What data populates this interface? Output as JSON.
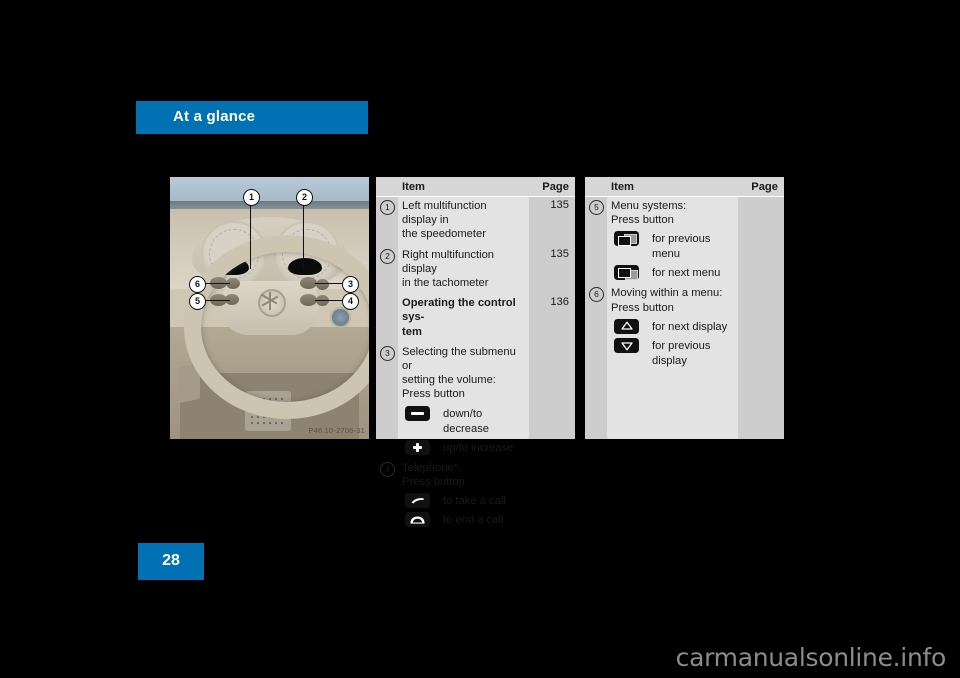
{
  "header": {
    "title": "At a glance"
  },
  "figure": {
    "code": "P46.10-2706-31",
    "callouts": [
      "1",
      "2",
      "3",
      "4",
      "5",
      "6"
    ]
  },
  "tables": [
    {
      "name": "left-table",
      "headers": {
        "item": "Item",
        "page": "Page"
      },
      "rows": [
        {
          "num": "1",
          "lines": [
            "Left multifunction display in",
            "the speedometer"
          ],
          "bold": false,
          "page": "135"
        },
        {
          "num": "2",
          "lines": [
            "Right multifunction display",
            "in the tachometer"
          ],
          "bold": false,
          "page": "135"
        },
        {
          "num": "",
          "lines": [
            "Operating the control sys-",
            "tem"
          ],
          "bold": true,
          "page": "136"
        },
        {
          "num": "3",
          "lines": [
            "Selecting the submenu or",
            "setting the volume:",
            "Press button"
          ],
          "bold": false,
          "page": ""
        }
      ],
      "icon_rows_a": [
        {
          "icon": "minus-button-icon",
          "label": "down/to decrease"
        },
        {
          "icon": "plus-button-icon",
          "label": "up/to increase"
        }
      ],
      "row_b": {
        "num": "4",
        "lines": [
          "Telephone*:",
          "Press button"
        ],
        "bold": false,
        "page": ""
      },
      "icon_rows_b": [
        {
          "icon": "phone-take-call-icon",
          "label": "to take a call"
        },
        {
          "icon": "phone-end-call-icon",
          "label": "to end a call"
        }
      ]
    },
    {
      "name": "right-table",
      "headers": {
        "item": "Item",
        "page": "Page"
      },
      "rows": [
        {
          "num": "5",
          "lines": [
            "Menu systems:",
            "Press button"
          ],
          "bold": false,
          "page": ""
        }
      ],
      "icon_rows_a": [
        {
          "icon": "previous-menu-icon",
          "label": "for previous menu"
        },
        {
          "icon": "next-menu-icon",
          "label": "for next menu"
        }
      ],
      "row_b": {
        "num": "6",
        "lines": [
          "Moving within a menu:",
          "Press button"
        ],
        "bold": false,
        "page": ""
      },
      "icon_rows_b": [
        {
          "icon": "arrow-up-icon",
          "label": "for next display"
        },
        {
          "icon": "arrow-down-icon",
          "label": "for previous display"
        }
      ]
    }
  ],
  "footer": {
    "page_number": "28",
    "watermark": "carmanualsonline.info"
  },
  "colors": {
    "accent": "#0072b4",
    "table_bg": "#e3e3e3",
    "table_gutter": "#cdcdcd",
    "header_row": "#d6d6d6"
  }
}
